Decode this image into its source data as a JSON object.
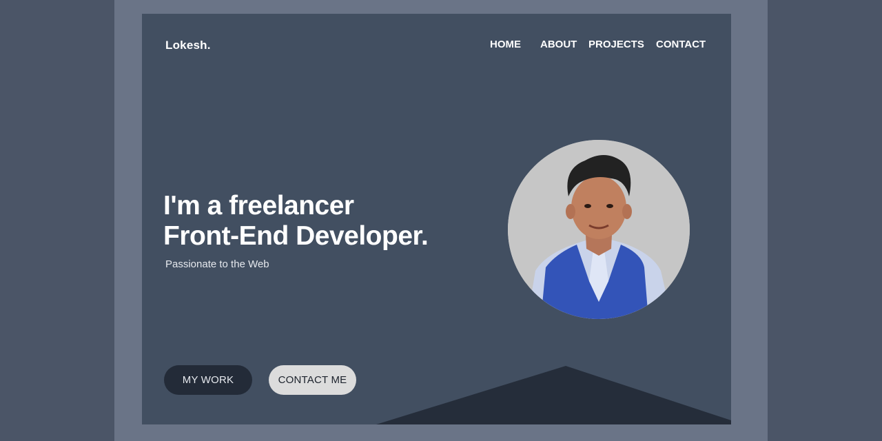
{
  "header": {
    "logo": "Lokesh.",
    "nav": [
      {
        "label": "HOME"
      },
      {
        "label": "ABOUT"
      },
      {
        "label": "PROJECTS"
      },
      {
        "label": "CONTACT"
      }
    ]
  },
  "hero": {
    "title_line1": "I'm a freelancer",
    "title_line2": "Front-End Developer.",
    "subtitle": "Passionate to the Web"
  },
  "buttons": {
    "my_work": "MY WORK",
    "contact_me": "CONTACT ME"
  },
  "colors": {
    "page_background": "#4b5567",
    "frame": "#6a7487",
    "card": "#424f61",
    "dark_accent": "#232b38",
    "light_button": "#dcdcdc"
  }
}
